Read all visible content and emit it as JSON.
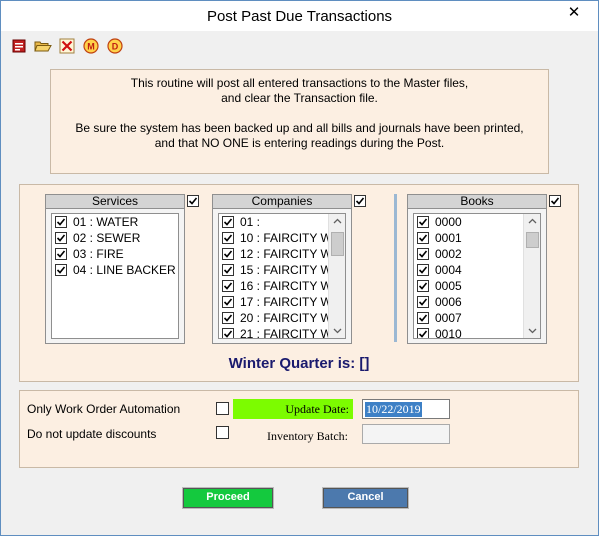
{
  "window": {
    "title": "Post Past Due Transactions",
    "close_glyph": "✕"
  },
  "toolbar": {
    "icons": [
      "form-icon",
      "open-folder-icon",
      "delete-icon",
      "m-circle-icon",
      "d-circle-icon"
    ],
    "m_letter": "M",
    "d_letter": "D"
  },
  "info": {
    "line1": "This routine will post all entered transactions to the Master files,",
    "line2": "and clear the Transaction file.",
    "line3": "Be sure the system has been backed up and all bills and journals have been printed,",
    "line4": "and that NO ONE is entering readings during the Post."
  },
  "services": {
    "header": "Services",
    "items": [
      "01 : WATER",
      "02 : SEWER",
      "03 : FIRE",
      "04 : LINE BACKER"
    ]
  },
  "companies": {
    "header": "Companies",
    "items": [
      "01 :",
      "10 : FAIRCITY W",
      "12 : FAIRCITY W",
      "15 : FAIRCITY W",
      "16 : FAIRCITY W",
      "17 : FAIRCITY W",
      "20 : FAIRCITY W",
      "21 : FAIRCITY W"
    ]
  },
  "books": {
    "header": "Books",
    "items": [
      "0000",
      "0001",
      "0002",
      "0004",
      "0005",
      "0006",
      "0007",
      "0010"
    ]
  },
  "winter_quarter": "Winter Quarter is: []",
  "options": {
    "work_order_label": "Only Work Order Automation",
    "discounts_label": "Do not update discounts",
    "update_date_label": "Update Date:",
    "update_date_value": "10/22/2019",
    "inventory_batch_label": "Inventory Batch:",
    "inventory_batch_value": ""
  },
  "buttons": {
    "proceed": "Proceed",
    "cancel": "Cancel"
  },
  "colors": {
    "proceed": "#14c93e",
    "cancel": "#4c79ad",
    "update_label_bg": "#7cfc00",
    "panel_bg": "#fcefe2"
  }
}
